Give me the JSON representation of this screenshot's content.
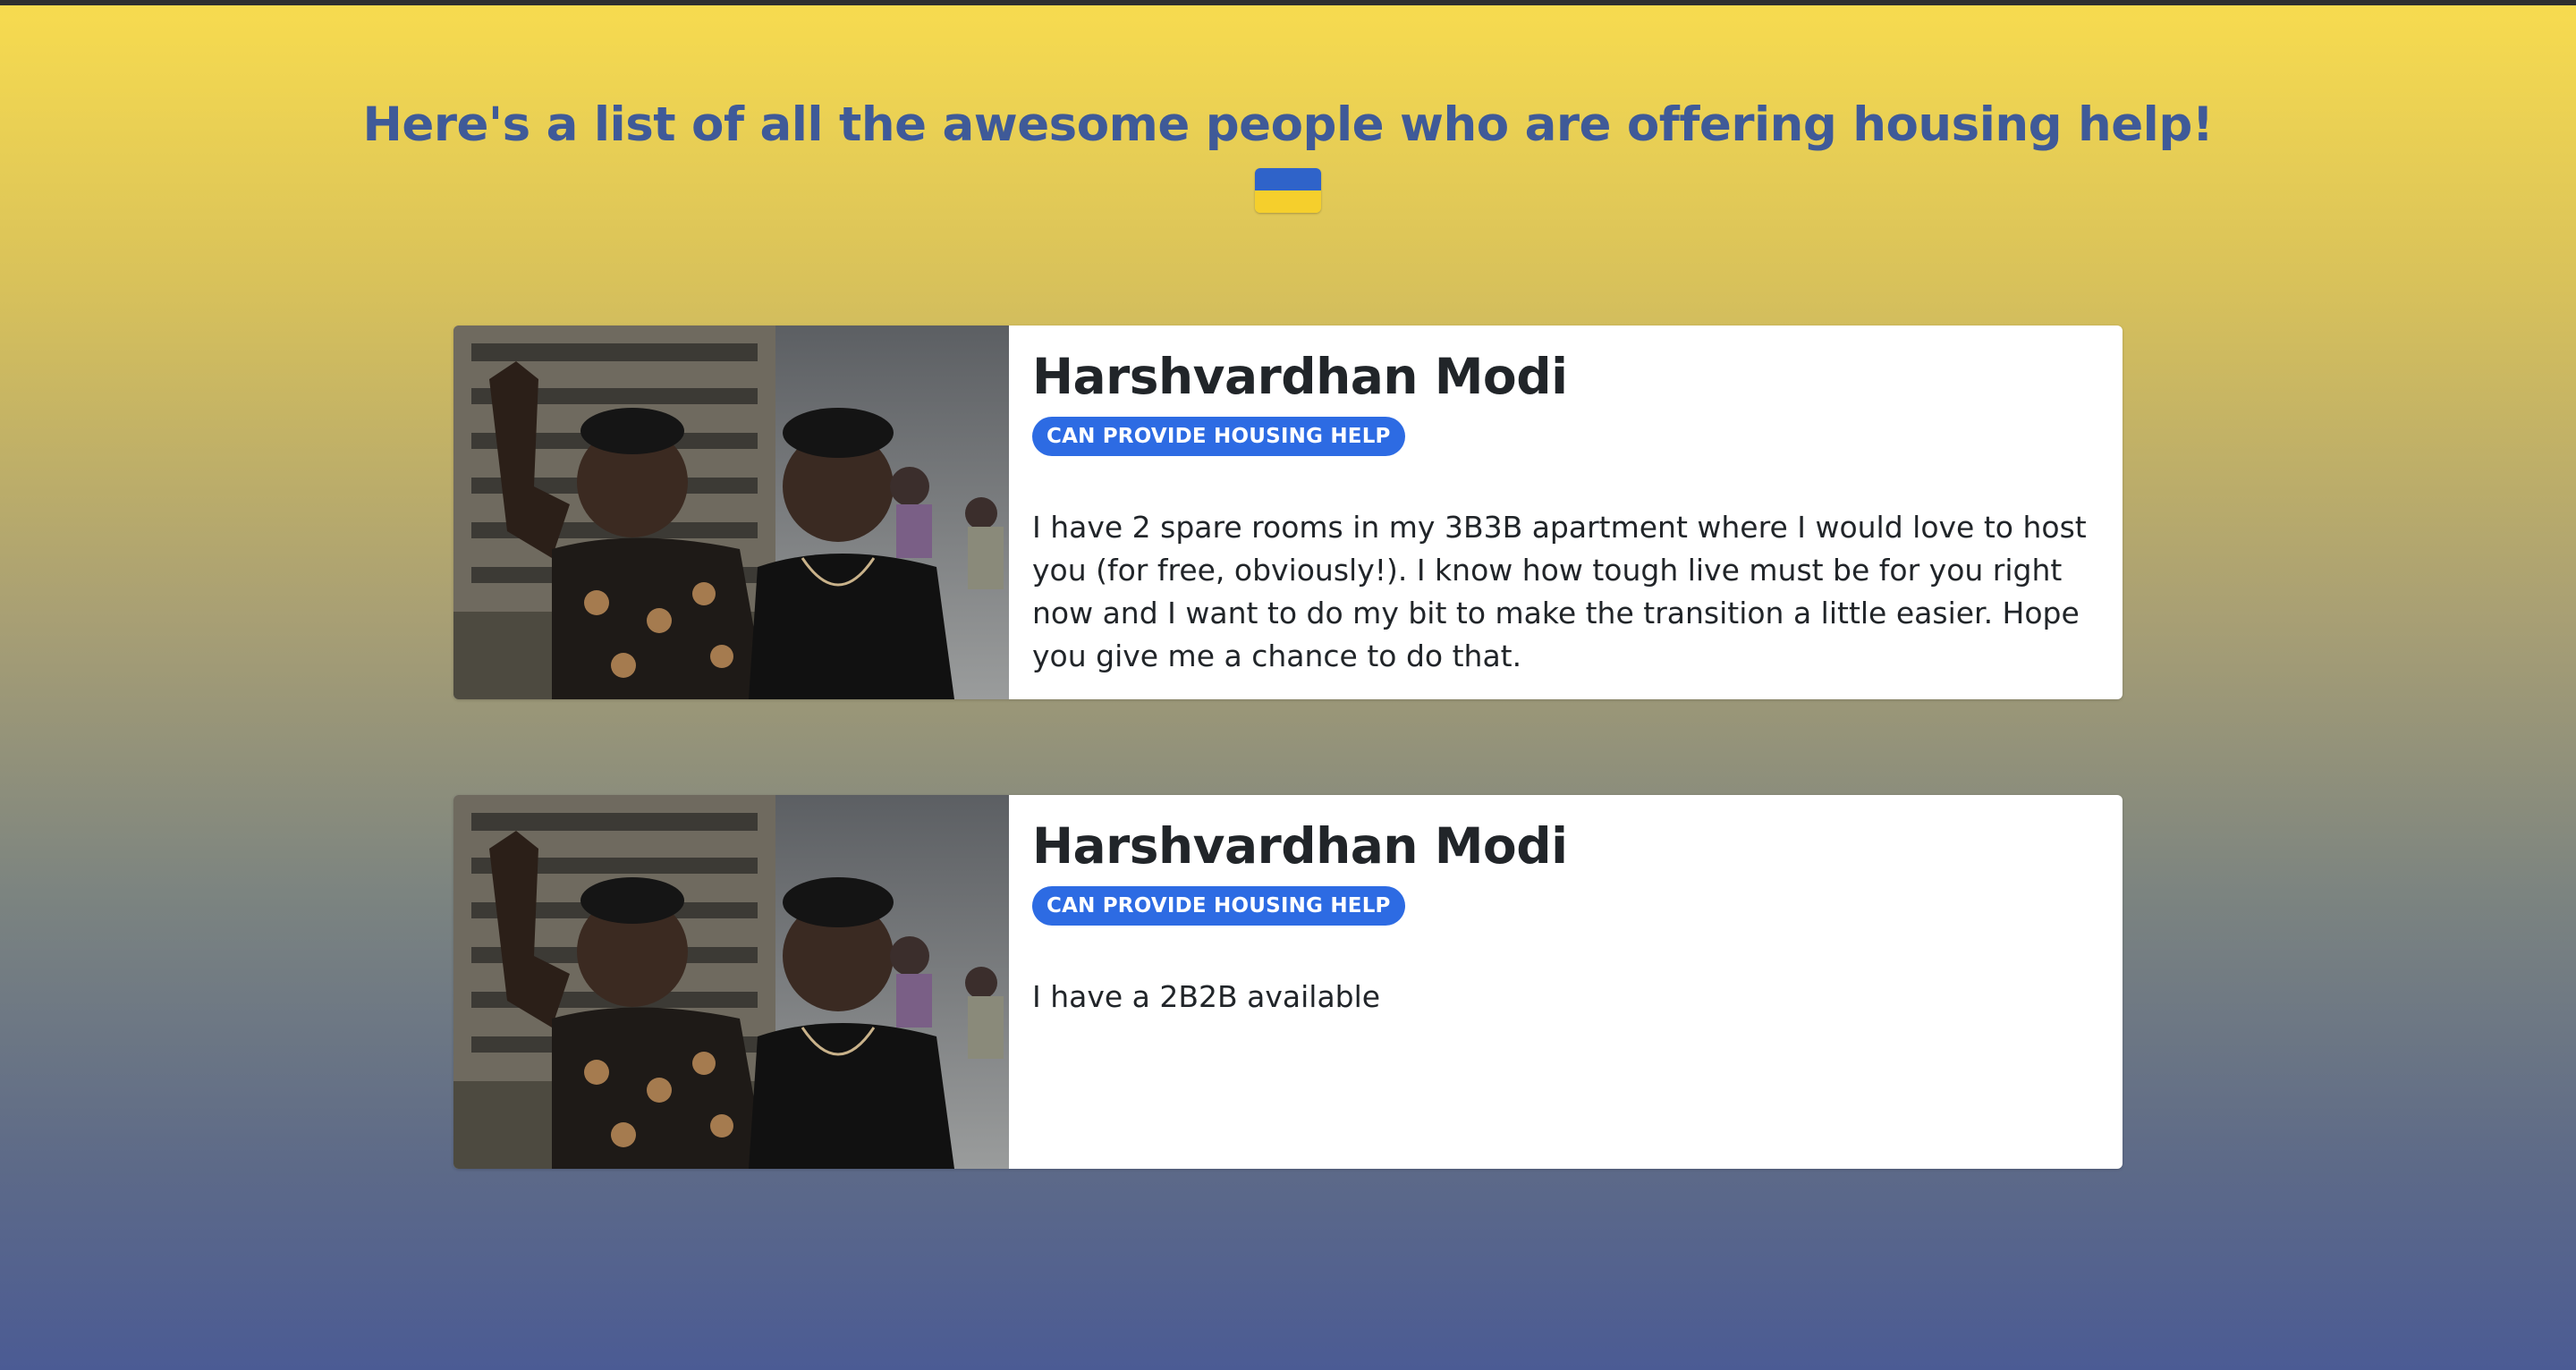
{
  "page": {
    "heading": "Here's a list of all the awesome people who are offering housing help!",
    "flag_icon": "ukraine-flag-icon"
  },
  "colors": {
    "heading": "#3f5a98",
    "badge": "#2d6be3",
    "flag_blue": "#2f63c9",
    "flag_yellow": "#f5cf2c"
  },
  "listings": [
    {
      "name": "Harshvardhan Modi",
      "badge": "CAN PROVIDE HOUSING HELP",
      "description": "I have 2 spare rooms in my 3B3B apartment where I would love to host you (for free, obviously!). I know how tough live must be for you right now and I want to do my bit to make the transition a little easier. Hope you give me a chance to do that."
    },
    {
      "name": "Harshvardhan Modi",
      "badge": "CAN PROVIDE HOUSING HELP",
      "description": "I have a 2B2B available"
    }
  ]
}
